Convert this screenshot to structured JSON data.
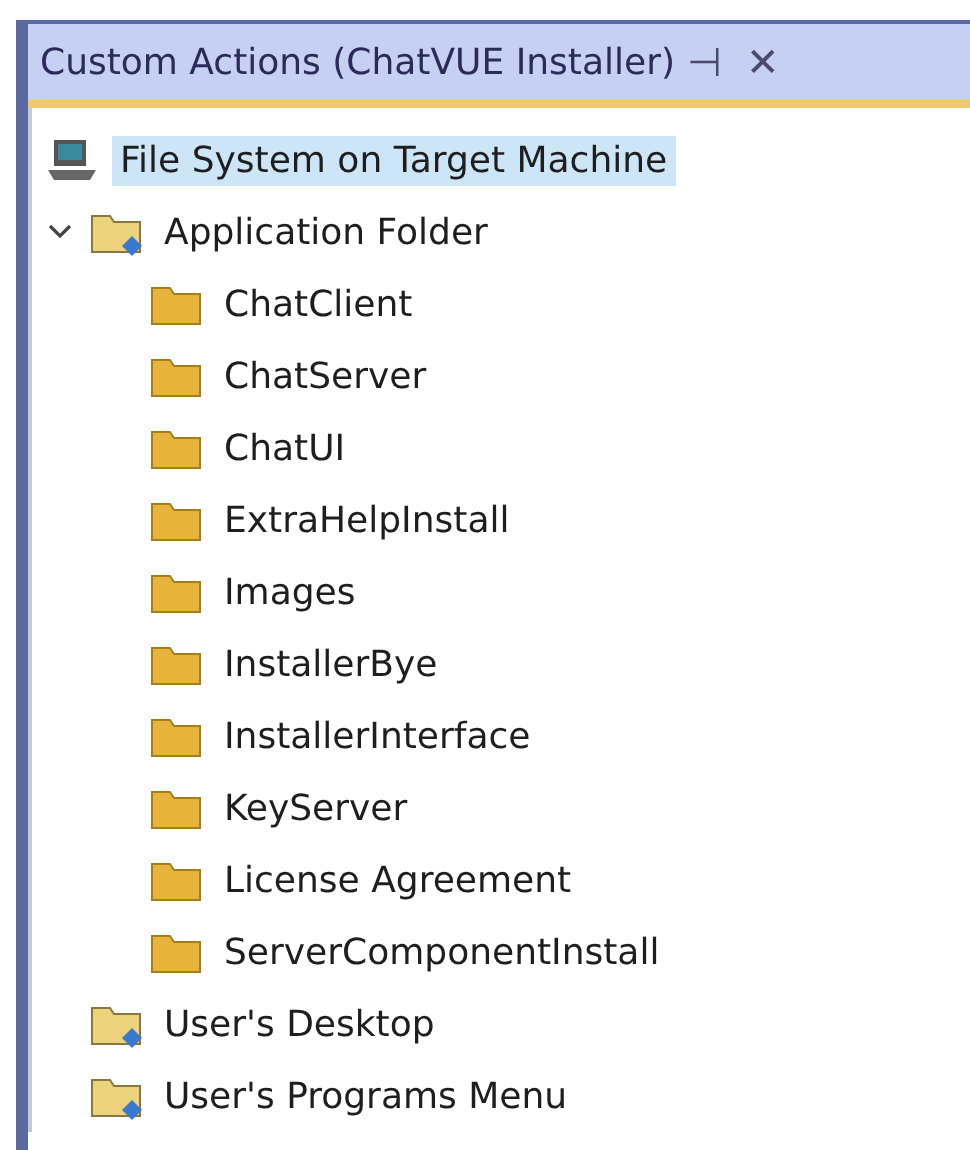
{
  "panel": {
    "title": "Custom Actions (ChatVUE Installer)",
    "pin": "⊣",
    "close": "✕"
  },
  "tree": [
    {
      "label": "File System on Target Machine",
      "kind": "computer",
      "selected": true,
      "children": [
        {
          "label": "Application Folder",
          "kind": "special",
          "selected": false,
          "expanded": true,
          "children": [
            {
              "label": "ChatClient",
              "kind": "folder",
              "selected": false
            },
            {
              "label": "ChatServer",
              "kind": "folder",
              "selected": false
            },
            {
              "label": "ChatUI",
              "kind": "folder",
              "selected": false
            },
            {
              "label": "ExtraHelpInstall",
              "kind": "folder",
              "selected": false
            },
            {
              "label": "Images",
              "kind": "folder",
              "selected": false
            },
            {
              "label": "InstallerBye",
              "kind": "folder",
              "selected": false
            },
            {
              "label": "InstallerInterface",
              "kind": "folder",
              "selected": false
            },
            {
              "label": "KeyServer",
              "kind": "folder",
              "selected": false
            },
            {
              "label": "License Agreement",
              "kind": "folder",
              "selected": false
            },
            {
              "label": "ServerComponentInstall",
              "kind": "folder",
              "selected": false
            }
          ]
        },
        {
          "label": "User's Desktop",
          "kind": "special",
          "selected": false
        },
        {
          "label": "User's Programs Menu",
          "kind": "special",
          "selected": false
        }
      ]
    }
  ]
}
